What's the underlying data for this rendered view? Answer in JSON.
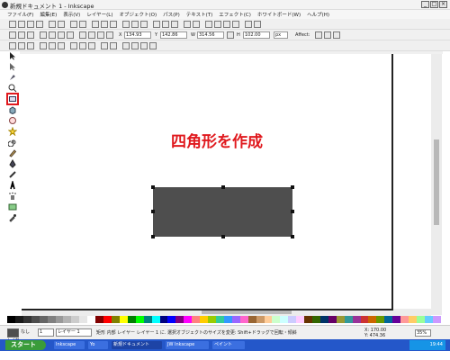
{
  "window": {
    "title": "新規ドキュメント 1 - Inkscape",
    "controls": {
      "minimize": "_",
      "maximize": "□",
      "close": "×"
    }
  },
  "menu": [
    "ファイル(F)",
    "編集(E)",
    "表示(V)",
    "レイヤー(L)",
    "オブジェクト(O)",
    "パス(P)",
    "テキスト(T)",
    "エフェクト(C)",
    "ホワイトボード(W)",
    "ヘルプ(H)"
  ],
  "tool_controls": {
    "x": "134.93",
    "y": "142.86",
    "w": "314.56",
    "h": "102.00",
    "unit": "px",
    "affect_label": "Affect:"
  },
  "tools": [
    "selector-tool",
    "node-tool",
    "tweak-tool",
    "zoom-tool",
    "rectangle-tool",
    "3d-box-tool",
    "ellipse-tool",
    "star-tool",
    "spiral-tool",
    "pencil-tool",
    "pen-tool",
    "calligraphy-tool",
    "text-tool",
    "spray-tool",
    "gradient-tool",
    "dropper-tool"
  ],
  "active_tool": "rectangle-tool",
  "canvas": {
    "annotation": "四角形を作成",
    "annotation_color": "#e0191e",
    "rect_fill": "#4e4e4e"
  },
  "palette_colors": [
    "#000000",
    "#1a1a1a",
    "#333333",
    "#4d4d4d",
    "#666666",
    "#808080",
    "#999999",
    "#b3b3b3",
    "#cccccc",
    "#e6e6e6",
    "#ffffff",
    "#800000",
    "#ff0000",
    "#808000",
    "#ffff00",
    "#008000",
    "#00ff00",
    "#008080",
    "#00ffff",
    "#000080",
    "#0000ff",
    "#800080",
    "#ff00ff",
    "#ff8080",
    "#ffcc00",
    "#99cc00",
    "#33cc99",
    "#3399ff",
    "#9966ff",
    "#ff66cc",
    "#996633",
    "#cc9966",
    "#ffcc99",
    "#ccffcc",
    "#ccffff",
    "#ccccff",
    "#ffccff",
    "#663300",
    "#336600",
    "#003366",
    "#660066",
    "#999933",
    "#339999",
    "#993399",
    "#cc3333",
    "#cc6600",
    "#669900",
    "#006699",
    "#660099",
    "#ff9999",
    "#ffcc66",
    "#99ff99",
    "#66ccff",
    "#cc99ff"
  ],
  "status": {
    "stroke_label": "なし",
    "opacity": "1",
    "layer": "レイヤー 1",
    "layer_label": "レイヤー",
    "message": "矩形 内部 レイヤー レイヤー 1 に. 選択オブジェクトのサイズを変更: Shift+ドラッグで回転・傾斜",
    "x_coord": "X: 170.00",
    "y_coord": "Y: 474.36",
    "zoom": "35%"
  },
  "taskbar": {
    "start": "スタート",
    "tasks": [
      "Inkscape",
      "Yo",
      "新規ドキュメント",
      "JW Inkscape",
      "ペイント"
    ],
    "clock": "19:44"
  }
}
